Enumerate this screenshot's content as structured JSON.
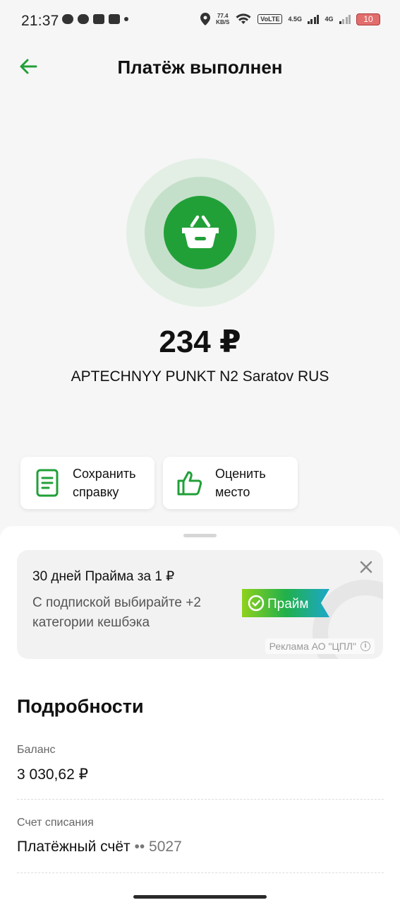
{
  "status_bar": {
    "time": "21:37",
    "speed_value": "77.4",
    "speed_unit": "KB/S",
    "volte": "VoLTE",
    "sim1_net": "4.5G",
    "sim2_net": "4G",
    "battery": "10"
  },
  "header": {
    "title": "Платёж выполнен",
    "back_icon": "arrow-left-icon"
  },
  "payment": {
    "amount": "234 ₽",
    "merchant": "APTECHNYY PUNKT N2 Saratov RUS",
    "icon": "shopping-basket-icon"
  },
  "actions": [
    {
      "label_line1": "Сохранить",
      "label_line2": "справку",
      "icon": "document-icon"
    },
    {
      "label_line1": "Оценить",
      "label_line2": "место",
      "icon": "thumbs-up-icon"
    }
  ],
  "promo": {
    "title": "30 дней Прайма за 1 ₽",
    "text": "С подпиской выбирайте +2 категории кешбэка",
    "badge": "Прайм",
    "ad_note": "Реклама АО \"ЦПЛ\""
  },
  "details": {
    "title": "Подробности",
    "balance_label": "Баланс",
    "balance_value": "3 030,62 ₽",
    "account_label": "Счет списания",
    "account_name": "Платёжный счёт",
    "account_masked": "•• 5027"
  },
  "colors": {
    "brand_green": "#21a038",
    "background": "#f6f6f6"
  }
}
